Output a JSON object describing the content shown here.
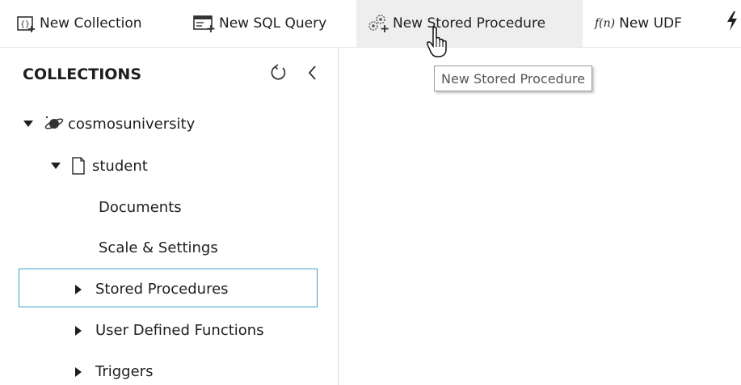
{
  "toolbar": {
    "new_collection": "New Collection",
    "new_sql_query": "New SQL Query",
    "new_stored_procedure": "New Stored Procedure",
    "udf_glyph": "f(n)",
    "new_udf": "New UDF"
  },
  "tooltip": {
    "text": "New Stored Procedure"
  },
  "sidebar": {
    "title": "COLLECTIONS",
    "tree": {
      "database": "cosmosuniversity",
      "collection": "student",
      "items": [
        "Documents",
        "Scale & Settings",
        "Stored Procedures",
        "User Defined Functions",
        "Triggers"
      ]
    }
  },
  "colors": {
    "selection_border": "#3aa0d6",
    "hover_background": "#eeeeee",
    "text": "#1e1e1e"
  },
  "icons": [
    "new-collection-icon",
    "new-sql-query-icon",
    "new-stored-procedure-icon",
    "udf-icon",
    "bolt-icon",
    "refresh-icon",
    "collapse-icon",
    "planet-icon",
    "document-icon",
    "caret-down-icon",
    "caret-right-icon",
    "hand-cursor-icon"
  ]
}
